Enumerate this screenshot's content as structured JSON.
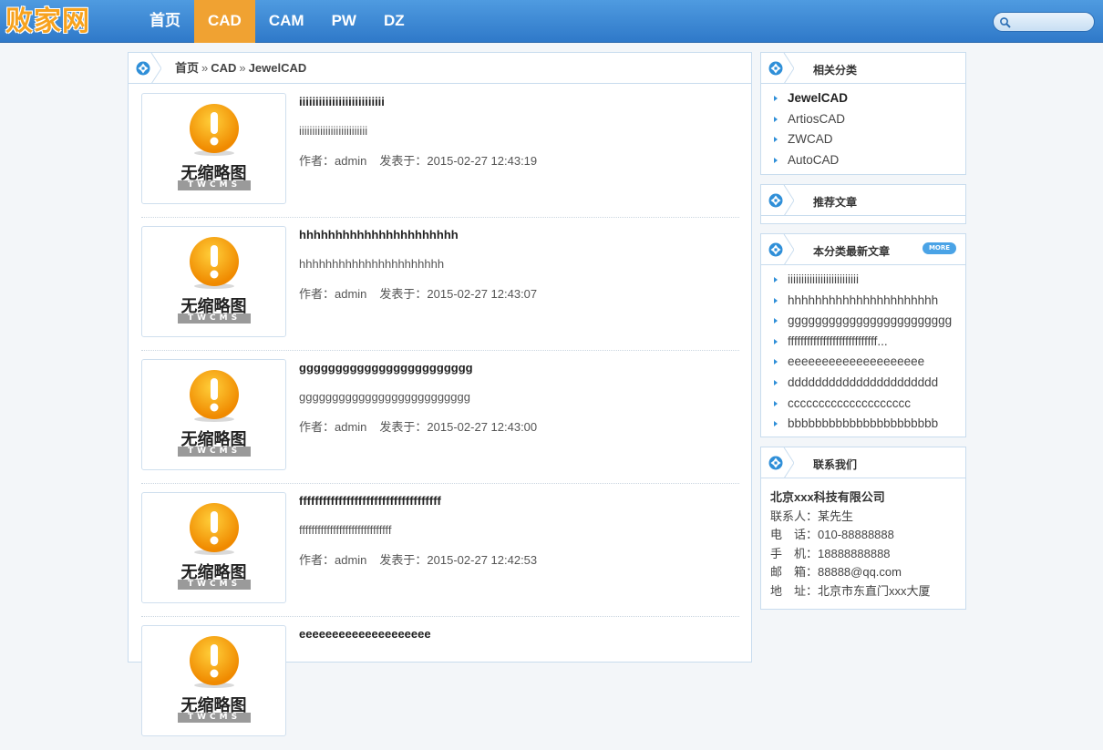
{
  "header": {
    "logo": "败家网",
    "nav": [
      {
        "label": "首页",
        "active": false
      },
      {
        "label": "CAD",
        "active": true
      },
      {
        "label": "CAM",
        "active": false
      },
      {
        "label": "PW",
        "active": false
      },
      {
        "label": "DZ",
        "active": false
      }
    ],
    "search_icon": "search-icon"
  },
  "breadcrumb": {
    "home": "首页",
    "sep": "»",
    "cat": "CAD",
    "sub": "JewelCAD"
  },
  "thumb": {
    "no_image": "无缩略图",
    "brand": "TWCMS"
  },
  "articles": [
    {
      "title": "iiiiiiiiiiiiiiiiiiiiiiiiii",
      "desc": "iiiiiiiiiiiiiiiiiiiiiiiiii",
      "author": "作者：admin",
      "date": "发表于：2015-02-27 12:43:19"
    },
    {
      "title": "hhhhhhhhhhhhhhhhhhhhhh",
      "desc": "hhhhhhhhhhhhhhhhhhhhhh",
      "author": "作者：admin",
      "date": "发表于：2015-02-27 12:43:07"
    },
    {
      "title": "gggggggggggggggggggggggg",
      "desc": "gggggggggggggggggggggggggg",
      "author": "作者：admin",
      "date": "发表于：2015-02-27 12:43:00"
    },
    {
      "title": "ffffffffffffffffffffffffffffffffffff",
      "desc": "ffffffffffffffffffffffffffffff",
      "author": "作者：admin",
      "date": "发表于：2015-02-27 12:42:53"
    },
    {
      "title": "eeeeeeeeeeeeeeeeeeee",
      "desc": "",
      "author": "",
      "date": ""
    }
  ],
  "sidebar": {
    "related": {
      "title": "相关分类",
      "items": [
        "JewelCAD",
        "ArtiosCAD",
        "ZWCAD",
        "AutoCAD"
      ]
    },
    "recommend": {
      "title": "推荐文章"
    },
    "latest": {
      "title": "本分类最新文章",
      "more": "MORE",
      "items": [
        "iiiiiiiiiiiiiiiiiiiiiiiiii",
        "hhhhhhhhhhhhhhhhhhhhhh",
        "gggggggggggggggggggggggg",
        "ffffffffffffffffffffffffffff...",
        "eeeeeeeeeeeeeeeeeeee",
        "dddddddddddddddddddddd",
        "cccccccccccccccccccc",
        "bbbbbbbbbbbbbbbbbbbbbb"
      ]
    },
    "contact": {
      "title": "联系我们",
      "company": "北京xxx科技有限公司",
      "person": "联系人：某先生",
      "phone": "电　话：010-88888888",
      "mobile": "手　机：18888888888",
      "email": "邮　箱：88888@qq.com",
      "address": "地　址：北京市东直门xxx大厦"
    }
  },
  "colors": {
    "header": "#3b8ad6",
    "active_nav": "#f0a232",
    "border": "#c8dcee",
    "accent": "#2f8fd8"
  }
}
